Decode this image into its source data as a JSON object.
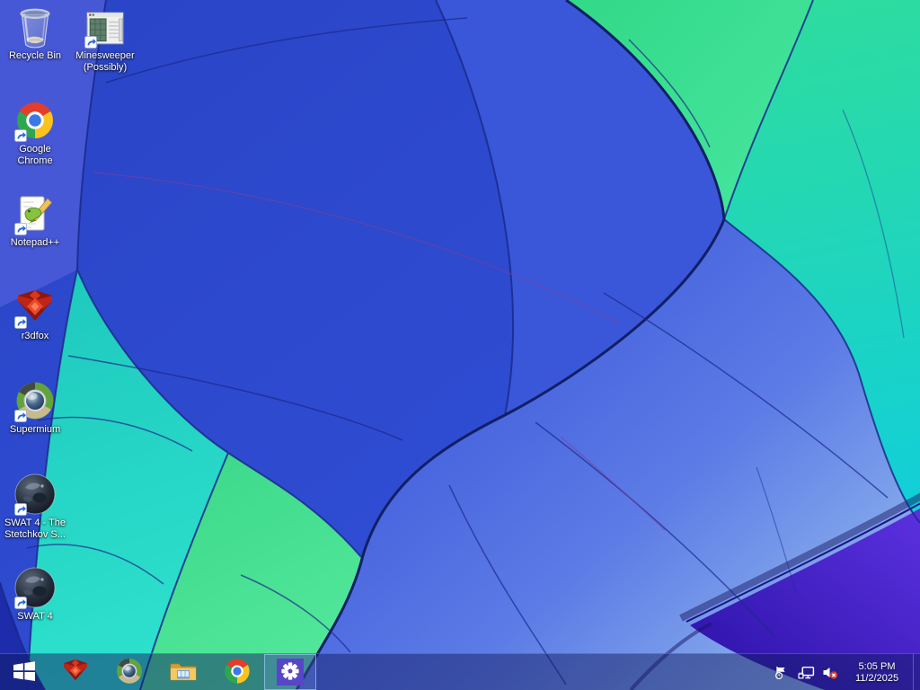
{
  "desktop": {
    "icons": [
      {
        "id": "recycle-bin",
        "label": "Recycle Bin",
        "lines": [
          "Recycle Bin"
        ],
        "shortcut": false
      },
      {
        "id": "minesweeper",
        "label": "Minesweeper (Possibly)",
        "lines": [
          "Minesweeper",
          "(Possibly)"
        ],
        "shortcut": true
      },
      {
        "id": "google-chrome",
        "label": "Google Chrome",
        "lines": [
          "Google",
          "Chrome"
        ],
        "shortcut": true
      },
      {
        "id": "notepad-plus-plus",
        "label": "Notepad++",
        "lines": [
          "Notepad++"
        ],
        "shortcut": true
      },
      {
        "id": "r3dfox",
        "label": "r3dfox",
        "lines": [
          "r3dfox"
        ],
        "shortcut": true
      },
      {
        "id": "supermium",
        "label": "Supermium",
        "lines": [
          "Supermium"
        ],
        "shortcut": true
      },
      {
        "id": "swat4-stetchkov",
        "label": "SWAT 4 - The Stetchkov S...",
        "lines": [
          "SWAT 4 - The",
          "Stetchkov S..."
        ],
        "shortcut": true
      },
      {
        "id": "swat4",
        "label": "SWAT 4",
        "lines": [
          "SWAT 4"
        ],
        "shortcut": true
      }
    ]
  },
  "taskbar": {
    "pinned": [
      "r3dfox",
      "supermium",
      "file-explorer",
      "google-chrome",
      "settings"
    ],
    "active_app": "settings",
    "tray_icons": [
      "action-center-flag",
      "network",
      "volume-muted"
    ],
    "clock": {
      "time": "5:05 PM",
      "date": "11/2/2025"
    }
  },
  "wallpaper": {
    "subject": "hot air balloon canopy close-up",
    "colors": {
      "royal_blue": "#2c49cf",
      "light_blue_gore": "#8fb6ee",
      "periwinkle": "#4758d6",
      "green": "#3eda8c",
      "teal": "#1fcabe",
      "cyan": "#12cfd8",
      "purple": "#4223c4",
      "navy_corner": "#1d2cab",
      "seam": "#1a2a8c"
    }
  }
}
